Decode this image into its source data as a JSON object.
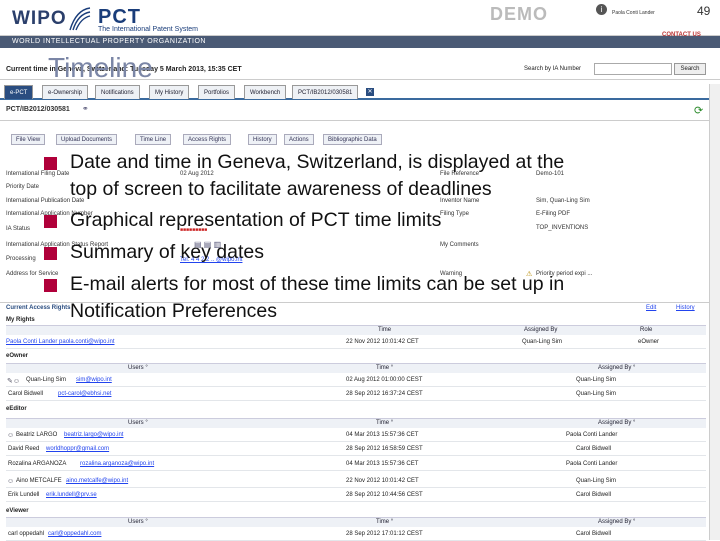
{
  "header": {
    "wipo_logo": "WIPO",
    "pct_logo": "PCT",
    "pct_subtitle": "The International Patent System",
    "org_band": "WORLD INTELLECTUAL PROPERTY ORGANIZATION",
    "demo": "DEMO",
    "user": "Paola Conti Lander",
    "page_number": "49",
    "contact": "CONTACT US"
  },
  "toolbar": {
    "current_time": "Current time in Geneva, Switzerland: Tuesday 5 March 2013, 15:35 CET",
    "search_label": "Search by IA Number",
    "search_button": "Search"
  },
  "slide_title": "Timeline",
  "main_tabs": [
    "e-PCT",
    "e-Ownership",
    "Notifications",
    "My History",
    "Portfolios",
    "Workbench",
    "PCT/IB2012/030581"
  ],
  "app_id": "PCT/IB2012/030581",
  "sub_tabs": [
    "File View",
    "Upload Documents",
    "Time Line",
    "Access Rights",
    "History",
    "Actions",
    "Bibliographic Data"
  ],
  "details_left": [
    {
      "label": "International Filing Date",
      "value": "02 Aug 2012"
    },
    {
      "label": "Priority Date",
      "value": ""
    },
    {
      "label": "International Publication Date",
      "value": ""
    },
    {
      "label": "International Application Number",
      "value": ""
    },
    {
      "label": "IA Status",
      "value": ""
    },
    {
      "label": "International Application Status Report",
      "value": ""
    },
    {
      "label": "Processing",
      "value": ""
    },
    {
      "label": "Address for Service",
      "value": "Tel: 4 4 2 2 .. @wipo.int"
    }
  ],
  "details_right": [
    {
      "label": "File Reference",
      "value": "Demo-101"
    },
    {
      "label": "",
      "value": ""
    },
    {
      "label": "Inventor Name",
      "value": "Sim, Quan-Ling Sim"
    },
    {
      "label": "Filing Type",
      "value": "E-Filing PDF"
    },
    {
      "label": "",
      "value": "TOP_INVENTIONS"
    },
    {
      "label": "My Comments",
      "value": ""
    },
    {
      "label": "Warning",
      "value": "Priority period expi ..."
    }
  ],
  "bullets": [
    {
      "line1": "Date and time in Geneva, Switzerland, is displayed at the",
      "line2": "top of screen to facilitate awareness of deadlines"
    },
    {
      "line1": "Graphical representation of PCT time limits",
      "line2": ""
    },
    {
      "line1": "Summary of key dates",
      "line2": ""
    },
    {
      "line1": "E-mail alerts for most of these time limits can be set up in",
      "line2": "Notification Preferences"
    }
  ],
  "access": {
    "section_title": "Current Access Rights",
    "edit": "Edit",
    "history": "History",
    "my_rights": "My Rights",
    "my_rights_headers": [
      "Time",
      "Assigned By",
      "Role"
    ],
    "my_rights_row": {
      "user": "Paola Conti Lander paola.conti@wipo.int",
      "time": "22 Nov 2012 10:01:42 CET",
      "by": "Quan-Ling Sim",
      "role": "eOwner"
    },
    "headers": [
      "Users °",
      "Time °",
      "Assigned By °"
    ],
    "groups": [
      {
        "role": "eOwner",
        "rows": [
          {
            "user": "Quan-Ling Sim",
            "email": "sim@wipo.int",
            "time": "02 Aug 2012 01:00:00 CEST",
            "by": "Quan-Ling Sim"
          },
          {
            "user": "Carol Bidwell",
            "email": "pct-carol@ebhsi.net",
            "time": "28 Sep 2012 16:37:24 CEST",
            "by": "Quan-Ling Sim"
          }
        ]
      },
      {
        "role": "eEditor",
        "rows": [
          {
            "user": "Beatriz LARGO",
            "email": "beatriz.largo@wipo.int",
            "time": "04 Mar 2013 15:57:36 CET",
            "by": "Paola Conti Lander"
          },
          {
            "user": "David Reed",
            "email": "worldhoppr@gmail.com",
            "time": "28 Sep 2012 16:58:59 CEST",
            "by": "Carol Bidwell"
          },
          {
            "user": "Rozalina ARGANOZA",
            "email": "rozalina.arganoza@wipo.int",
            "time": "04 Mar 2013 15:57:36 CET",
            "by": "Paola Conti Lander"
          },
          {
            "user": "Aino METCALFE",
            "email": "aino.metcalfe@wipo.int",
            "time": "22 Nov 2012 10:01:42 CET",
            "by": "Quan-Ling Sim"
          },
          {
            "user": "Erik Lundell",
            "email": "erik.lundell@prv.se",
            "time": "28 Sep 2012 10:44:56 CEST",
            "by": "Carol Bidwell"
          }
        ]
      },
      {
        "role": "eViewer",
        "rows": [
          {
            "user": "carl oppedahl",
            "email": "carl@oppedahl.com",
            "time": "28 Sep 2012 17:01:12 CEST",
            "by": "Carol Bidwell"
          }
        ]
      }
    ]
  }
}
